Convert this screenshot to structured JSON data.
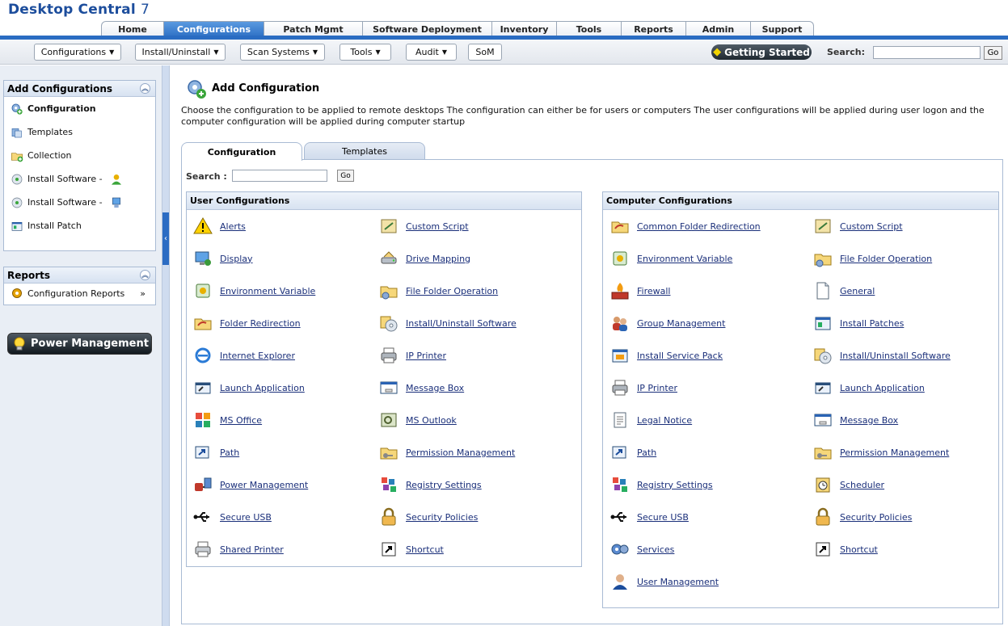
{
  "app": {
    "title": "Desktop Central",
    "version": "7"
  },
  "tabs": [
    {
      "label": "Home",
      "active": false
    },
    {
      "label": "Configurations",
      "active": true
    },
    {
      "label": "Patch Mgmt",
      "active": false
    },
    {
      "label": "Software Deployment",
      "active": false
    },
    {
      "label": "Inventory",
      "active": false
    },
    {
      "label": "Tools",
      "active": false
    },
    {
      "label": "Reports",
      "active": false
    },
    {
      "label": "Admin",
      "active": false
    },
    {
      "label": "Support",
      "active": false
    }
  ],
  "toolbar": {
    "menus": [
      "Configurations",
      "Install/Uninstall",
      "Scan Systems",
      "Tools",
      "Audit"
    ],
    "som": "SoM",
    "getting_started": "Getting Started",
    "search_label": "Search:",
    "search_value": "",
    "go": "Go"
  },
  "sidebar": {
    "add_configurations": {
      "title": "Add Configurations",
      "items": [
        {
          "label": "Configuration",
          "icon": "gear-add-icon",
          "active": true
        },
        {
          "label": "Templates",
          "icon": "templates-icon"
        },
        {
          "label": "Collection",
          "icon": "collection-add-icon"
        },
        {
          "label": "Install Software -",
          "icon": "software-install-icon",
          "suffix_icon": "user-icon"
        },
        {
          "label": "Install Software -",
          "icon": "software-install-icon",
          "suffix_icon": "computer-icon"
        },
        {
          "label": "Install Patch",
          "icon": "patch-icon"
        }
      ]
    },
    "reports": {
      "title": "Reports",
      "items": [
        {
          "label": "Configuration Reports",
          "icon": "gear-report-icon"
        }
      ]
    },
    "power_management": "Power Management"
  },
  "main": {
    "title": "Add Configuration",
    "description": "Choose the configuration to be applied to remote desktops The configuration can either be for users or computers The user configurations will be applied during user logon and the computer configuration will be applied during computer startup",
    "content_tabs": [
      {
        "label": "Configuration",
        "active": true
      },
      {
        "label": "Templates",
        "active": false
      }
    ],
    "search_label": "Search :",
    "search_value": "",
    "go": "Go",
    "user_configurations": {
      "title": "User Configurations",
      "items": [
        {
          "label": "Alerts",
          "icon": "alert-icon"
        },
        {
          "label": "Custom Script",
          "icon": "script-icon"
        },
        {
          "label": "Display",
          "icon": "display-icon"
        },
        {
          "label": "Drive Mapping",
          "icon": "drive-icon"
        },
        {
          "label": "Environment Variable",
          "icon": "env-variable-icon"
        },
        {
          "label": "File Folder Operation",
          "icon": "folder-gear-icon"
        },
        {
          "label": "Folder Redirection",
          "icon": "folder-redirect-icon"
        },
        {
          "label": "Install/Uninstall Software",
          "icon": "cd-box-icon"
        },
        {
          "label": "Internet Explorer",
          "icon": "ie-icon"
        },
        {
          "label": "IP Printer",
          "icon": "printer-icon"
        },
        {
          "label": "Launch Application",
          "icon": "launch-icon"
        },
        {
          "label": "Message Box",
          "icon": "message-box-icon"
        },
        {
          "label": "MS Office",
          "icon": "office-icon"
        },
        {
          "label": "MS Outlook",
          "icon": "outlook-icon"
        },
        {
          "label": "Path",
          "icon": "path-icon"
        },
        {
          "label": "Permission Management",
          "icon": "folder-key-icon"
        },
        {
          "label": "Power Management",
          "icon": "power-plug-icon"
        },
        {
          "label": "Registry Settings",
          "icon": "registry-icon"
        },
        {
          "label": "Secure USB",
          "icon": "usb-icon"
        },
        {
          "label": "Security Policies",
          "icon": "lock-icon"
        },
        {
          "label": "Shared Printer",
          "icon": "shared-printer-icon"
        },
        {
          "label": "Shortcut",
          "icon": "shortcut-icon"
        }
      ]
    },
    "computer_configurations": {
      "title": "Computer Configurations",
      "items": [
        {
          "label": "Common Folder Redirection",
          "icon": "folder-redirect-icon"
        },
        {
          "label": "Custom Script",
          "icon": "script-icon"
        },
        {
          "label": "Environment Variable",
          "icon": "env-variable-icon"
        },
        {
          "label": "File Folder Operation",
          "icon": "folder-gear-icon"
        },
        {
          "label": "Firewall",
          "icon": "firewall-icon"
        },
        {
          "label": "General",
          "icon": "document-icon"
        },
        {
          "label": "Group Management",
          "icon": "group-icon"
        },
        {
          "label": "Install Patches",
          "icon": "patch-icon"
        },
        {
          "label": "Install Service Pack",
          "icon": "service-pack-icon"
        },
        {
          "label": "Install/Uninstall Software",
          "icon": "cd-box-icon"
        },
        {
          "label": "IP Printer",
          "icon": "printer-icon"
        },
        {
          "label": "Launch Application",
          "icon": "launch-icon"
        },
        {
          "label": "Legal Notice",
          "icon": "notepad-icon"
        },
        {
          "label": "Message Box",
          "icon": "message-box-icon"
        },
        {
          "label": "Path",
          "icon": "path-icon"
        },
        {
          "label": "Permission Management",
          "icon": "folder-key-icon"
        },
        {
          "label": "Registry Settings",
          "icon": "registry-icon"
        },
        {
          "label": "Scheduler",
          "icon": "scheduler-icon"
        },
        {
          "label": "Secure USB",
          "icon": "usb-icon"
        },
        {
          "label": "Security Policies",
          "icon": "lock-icon"
        },
        {
          "label": "Services",
          "icon": "services-icon"
        },
        {
          "label": "Shortcut",
          "icon": "shortcut-icon"
        },
        {
          "label": "User Management",
          "icon": "user-management-icon"
        }
      ]
    }
  }
}
